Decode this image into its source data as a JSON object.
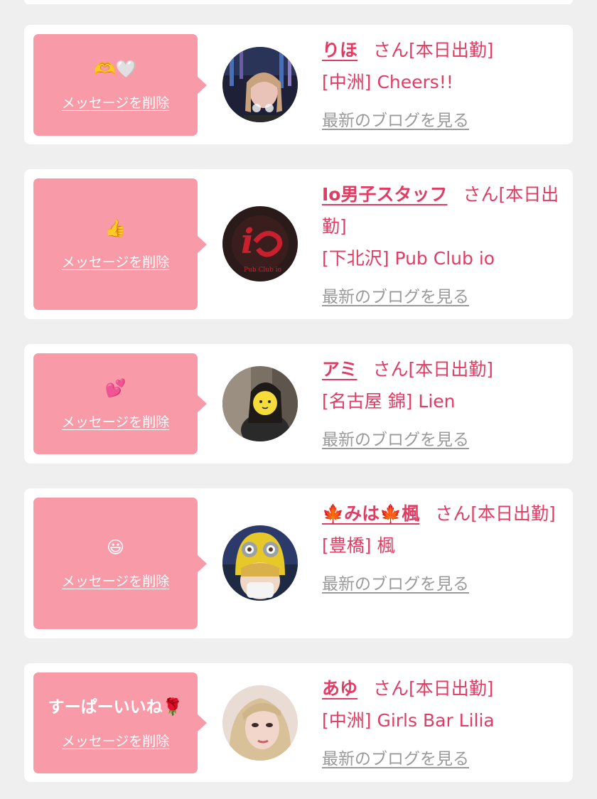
{
  "delete_label": "メッセージを削除",
  "blog_label": "最新のブログを見る",
  "honorific": "さん",
  "cards": [
    {
      "message": "🫶🤍",
      "name": "りほ",
      "status": "[本日出勤]",
      "shop": "[中洲] Cheers!!"
    },
    {
      "message": "👍",
      "name": "Io男子スタッフ",
      "status": "[本日出勤]",
      "shop": "[下北沢] Pub Club io"
    },
    {
      "message": "💕",
      "name": "アミ",
      "status": "[本日出勤]",
      "shop": "[名古屋 錦] Lien"
    },
    {
      "message": "😃",
      "name": "🍁みは🍁楓",
      "status": "[本日出勤]",
      "shop": "[豊橋] 楓"
    },
    {
      "message": "すーぱーいいね🌹",
      "name": "あゆ",
      "status": "[本日出勤]",
      "shop": "[中洲] Girls Bar Lilia"
    }
  ],
  "colors": {
    "accent": "#e03c64",
    "bubble": "#f99aa8",
    "link_gray": "#9a9a9a",
    "background": "#efefef"
  }
}
